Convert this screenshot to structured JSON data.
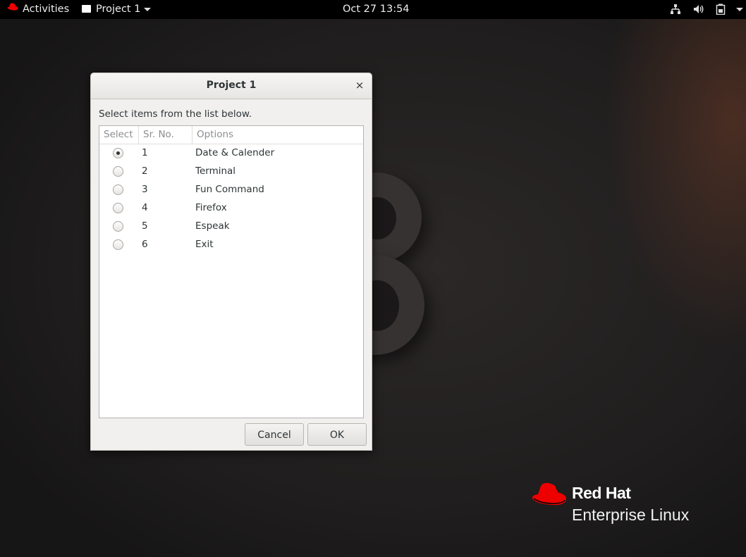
{
  "topbar": {
    "activities": "Activities",
    "app_menu": "Project 1",
    "clock": "Oct 27  13:54"
  },
  "dialog": {
    "title": "Project 1",
    "close_glyph": "×",
    "prompt": "Select items from the list below.",
    "columns": [
      "Select",
      "Sr. No.",
      "Options"
    ],
    "rows": [
      {
        "sr": "1",
        "option": "Date & Calender",
        "selected": true
      },
      {
        "sr": "2",
        "option": "Terminal",
        "selected": false
      },
      {
        "sr": "3",
        "option": "Fun Command",
        "selected": false
      },
      {
        "sr": "4",
        "option": "Firefox",
        "selected": false
      },
      {
        "sr": "5",
        "option": "Espeak",
        "selected": false
      },
      {
        "sr": "6",
        "option": "Exit",
        "selected": false
      }
    ],
    "cancel_label": "Cancel",
    "ok_label": "OK"
  },
  "logo": {
    "brand": "Red Hat",
    "product": "Enterprise Linux"
  },
  "colors": {
    "redhat_red": "#ee0000",
    "topbar": "#000000",
    "dialog_bg": "#f1f0ef"
  },
  "icons": [
    "redhat-icon",
    "window-icon",
    "network-icon",
    "volume-icon",
    "battery-icon",
    "power-menu-icon",
    "close-icon"
  ]
}
